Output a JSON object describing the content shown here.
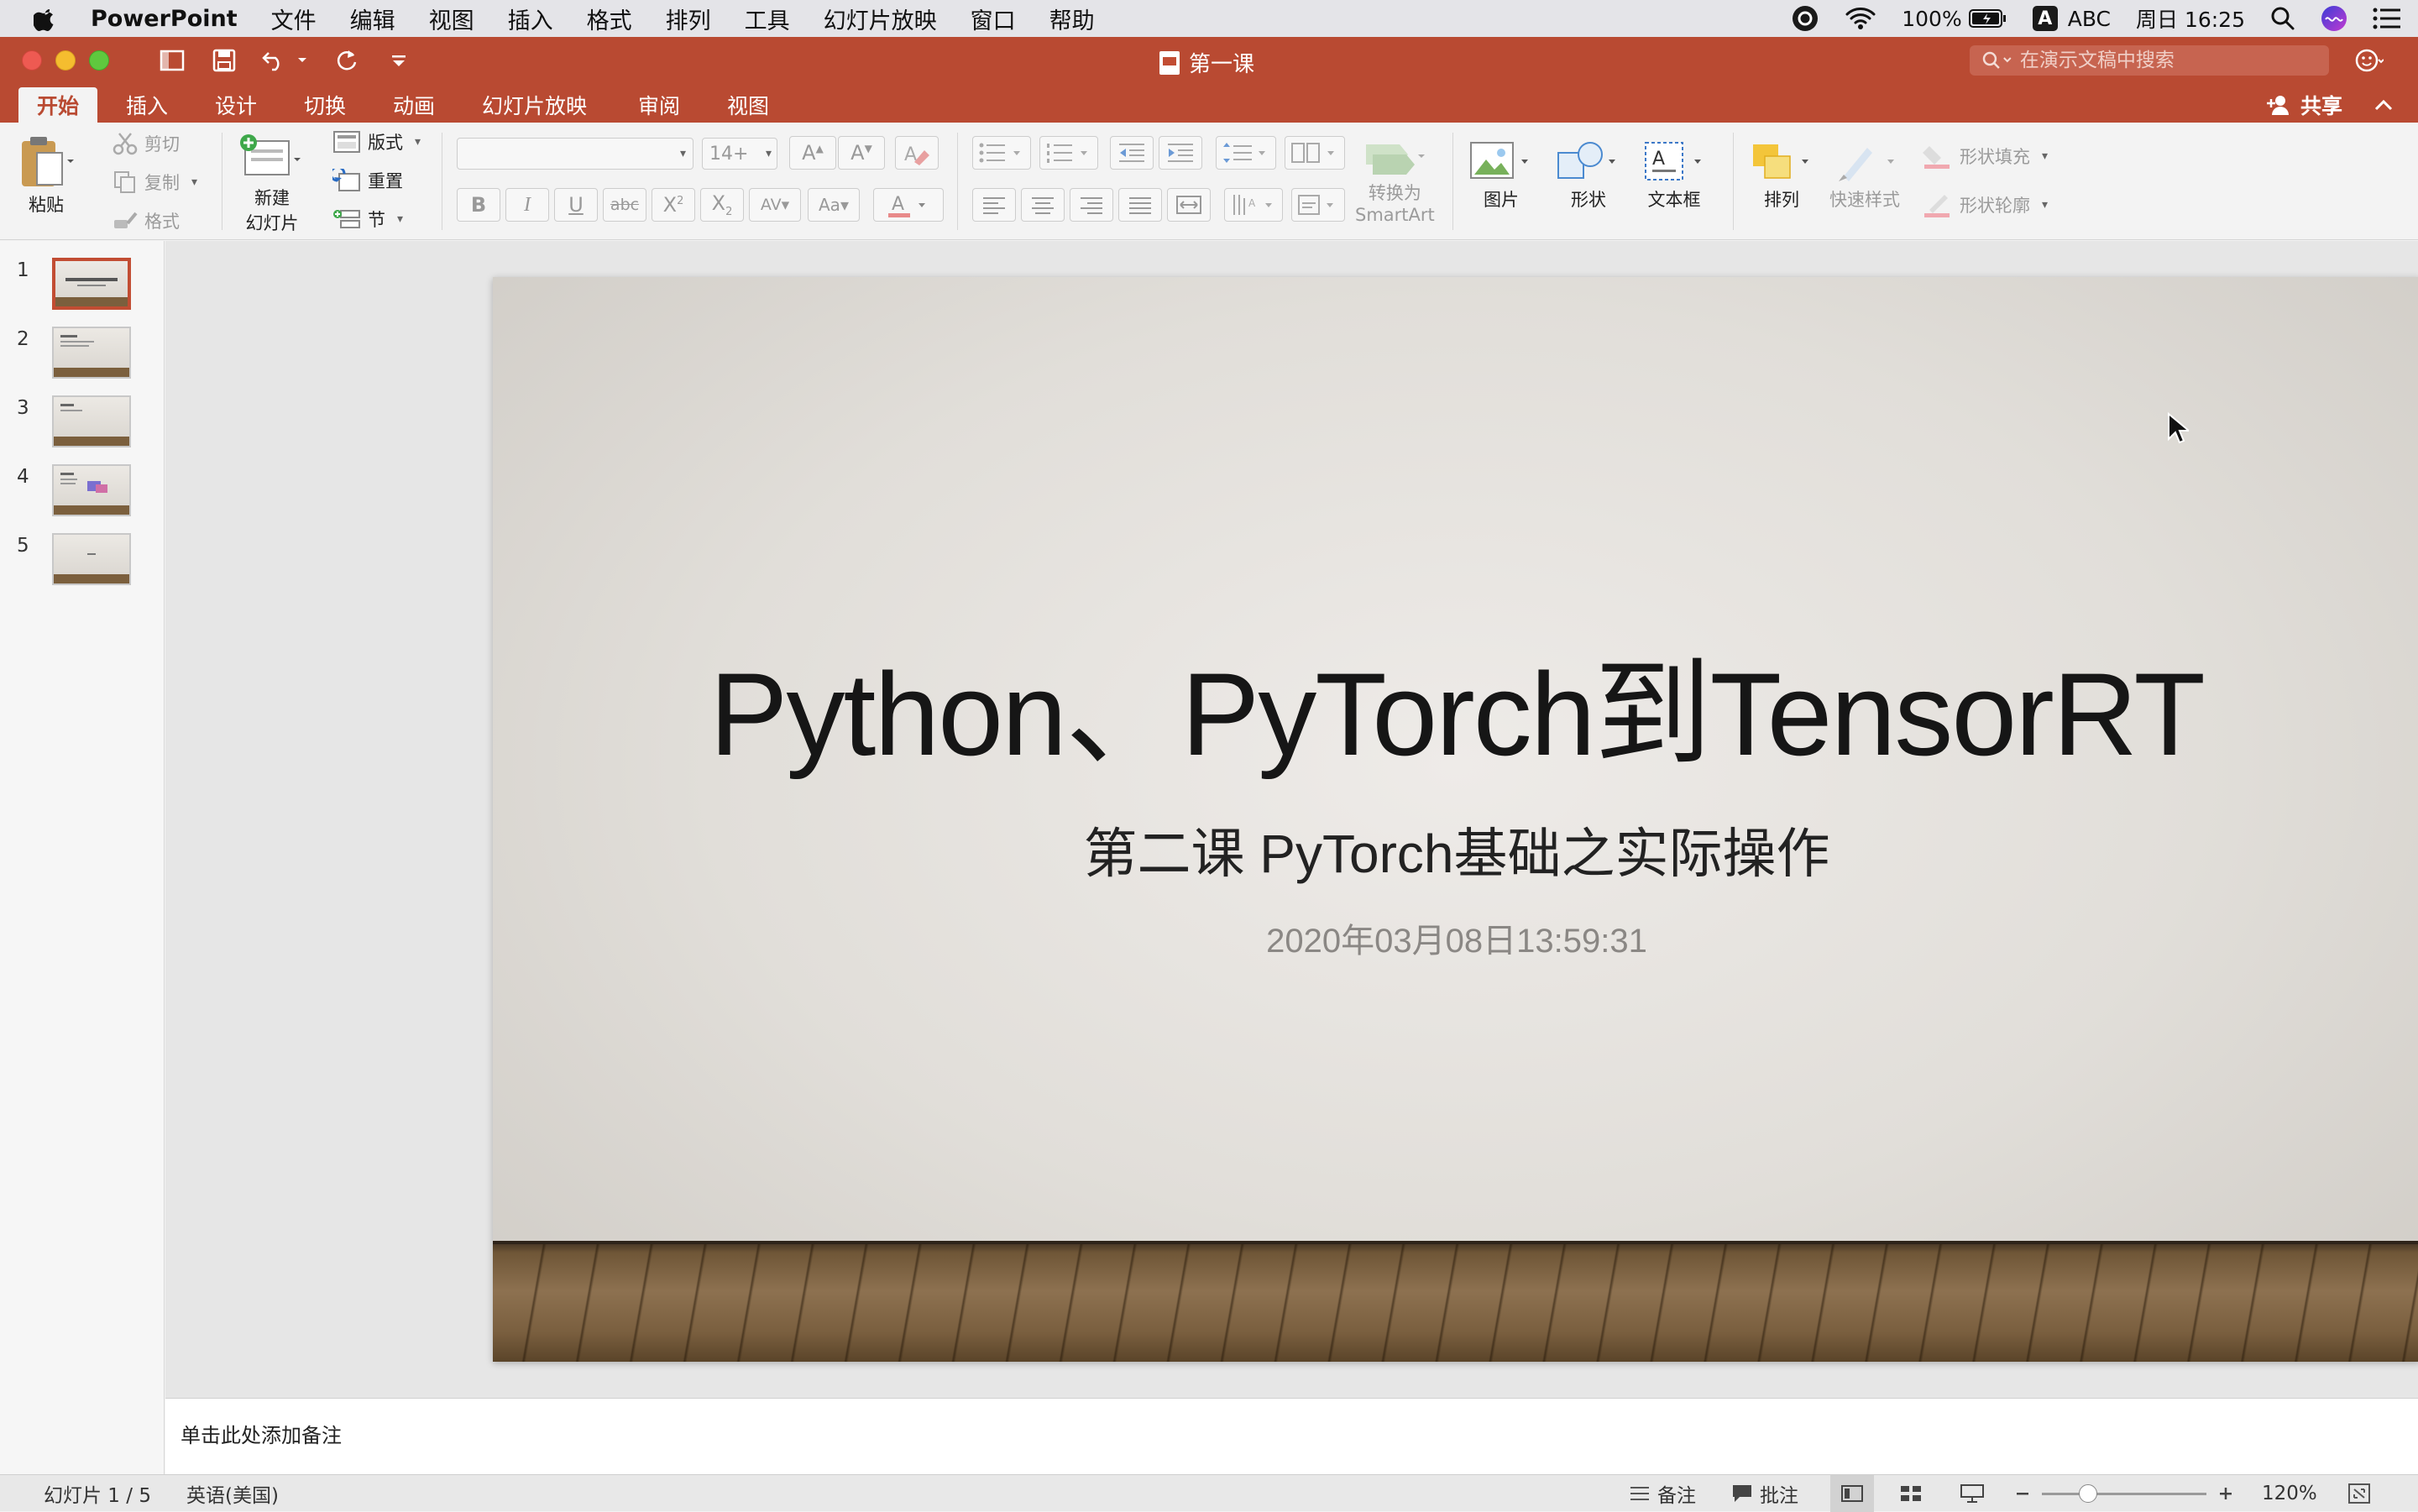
{
  "menubar": {
    "app_name": "PowerPoint",
    "items": [
      "文件",
      "编辑",
      "视图",
      "插入",
      "格式",
      "排列",
      "工具",
      "幻灯片放映",
      "窗口",
      "帮助"
    ],
    "battery": "100%",
    "ime_badge": "A",
    "ime": "ABC",
    "clock": "周日 16:25"
  },
  "titlebar": {
    "document_title": "第一课",
    "search_placeholder": "在演示文稿中搜索"
  },
  "tabs": {
    "items": [
      "开始",
      "插入",
      "设计",
      "切换",
      "动画",
      "幻灯片放映",
      "审阅",
      "视图"
    ],
    "active": "开始",
    "share": "共享"
  },
  "ribbon": {
    "paste": "粘贴",
    "cut": "剪切",
    "copy": "复制",
    "format_painter": "格式",
    "new_slide_line1": "新建",
    "new_slide_line2": "幻灯片",
    "layout": "版式",
    "reset": "重置",
    "section": "节",
    "font_name": "",
    "font_size": "14+",
    "convert_smartart_line1": "转换为",
    "convert_smartart_line2": "SmartArt",
    "picture": "图片",
    "shape": "形状",
    "textbox": "文本框",
    "arrange": "排列",
    "quick_styles": "快速样式",
    "shape_fill": "形状填充",
    "shape_outline": "形状轮廓"
  },
  "slides": {
    "numbers": [
      "1",
      "2",
      "3",
      "4",
      "5"
    ],
    "selected": 1
  },
  "slide": {
    "title": "Python、PyTorch到TensorRT",
    "subtitle": "第二课 PyTorch基础之实际操作",
    "date": "2020年03月08日13:59:31"
  },
  "notes": {
    "placeholder": "单击此处添加备注"
  },
  "statusbar": {
    "slide_counter": "幻灯片 1 / 5",
    "language": "英语(美国)",
    "notes_button": "备注",
    "comments_button": "批注",
    "zoom": "120%",
    "zoom_fraction": 0.28
  },
  "colors": {
    "accent": "#b94a32",
    "selected_thumb_border": "#c24d33"
  }
}
